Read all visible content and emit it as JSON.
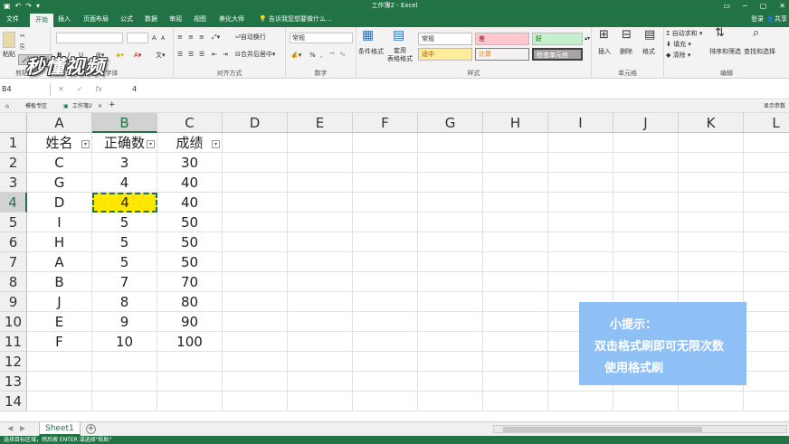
{
  "titlebar": {
    "title": "工作簿2 - Excel",
    "qat": [
      "↶",
      "↷",
      "▾"
    ],
    "controls": [
      "─",
      "▢",
      "✕"
    ]
  },
  "tabs": [
    {
      "label": "文件"
    },
    {
      "label": "开始",
      "active": true
    },
    {
      "label": "插入"
    },
    {
      "label": "页面布局"
    },
    {
      "label": "公式"
    },
    {
      "label": "数据"
    },
    {
      "label": "审阅"
    },
    {
      "label": "视图"
    },
    {
      "label": "美化大师"
    }
  ],
  "tellme": "告诉我您想要做什么...",
  "signin": "登录",
  "share": "共享",
  "ribbon": {
    "clipboard": {
      "paste": "粘贴",
      "format_painter": "格式刷",
      "label": "剪贴板"
    },
    "font": {
      "bold": "B",
      "italic": "I",
      "underline": "U",
      "grow": "A",
      "shrink": "A",
      "label": "字体"
    },
    "alignment": {
      "wrap": "自动换行",
      "merge": "合并后居中",
      "label": "对齐方式"
    },
    "number": {
      "format": "常规",
      "percent": "%",
      "comma": ",",
      "label": "数字"
    },
    "styles": {
      "conditional": "条件格式",
      "table": "套用\n表格格式",
      "cells": [
        "常规",
        "差",
        "好",
        "适中",
        "计算",
        "检查单元格"
      ],
      "label": "样式"
    },
    "cellsgroup": {
      "insert": "插入",
      "delete": "删除",
      "format": "格式",
      "label": "单元格"
    },
    "editing": {
      "autosum": "自动求和",
      "fill": "填充",
      "clear": "清除",
      "sort": "排序和筛选",
      "find": "查找和选择",
      "label": "编辑"
    }
  },
  "watermark": "秒懂视频",
  "formula_bar": {
    "namebox": "B4",
    "icons": [
      "✕",
      "✓",
      "fx"
    ],
    "content": "4"
  },
  "workbook_tabs": [
    {
      "label": "模板专区"
    },
    {
      "label": "工作簿2"
    },
    {
      "label": "+"
    }
  ],
  "workbook_tabs_right": "显示参数",
  "columns": [
    "A",
    "B",
    "C",
    "D",
    "E",
    "F",
    "G",
    "H",
    "I",
    "J",
    "K",
    "L"
  ],
  "rows": [
    "1",
    "2",
    "3",
    "4",
    "5",
    "6",
    "7",
    "8",
    "9",
    "10",
    "11",
    "12",
    "13",
    "14"
  ],
  "table": {
    "headers": [
      "姓名",
      "正确数",
      "成绩"
    ],
    "data": [
      [
        "C",
        "3",
        "30"
      ],
      [
        "G",
        "4",
        "40"
      ],
      [
        "D",
        "4",
        "40"
      ],
      [
        "I",
        "5",
        "50"
      ],
      [
        "H",
        "5",
        "50"
      ],
      [
        "A",
        "5",
        "50"
      ],
      [
        "B",
        "7",
        "70"
      ],
      [
        "J",
        "8",
        "80"
      ],
      [
        "E",
        "9",
        "90"
      ],
      [
        "F",
        "10",
        "100"
      ]
    ]
  },
  "tip": {
    "title": "小提示：",
    "line1": "双击格式刷即可无限次数",
    "line2": "使用格式刷"
  },
  "sheet": {
    "name": "Sheet1",
    "add": "+"
  },
  "statusbar": "选择目标区域，然后按 ENTER 或选择\"粘贴\""
}
